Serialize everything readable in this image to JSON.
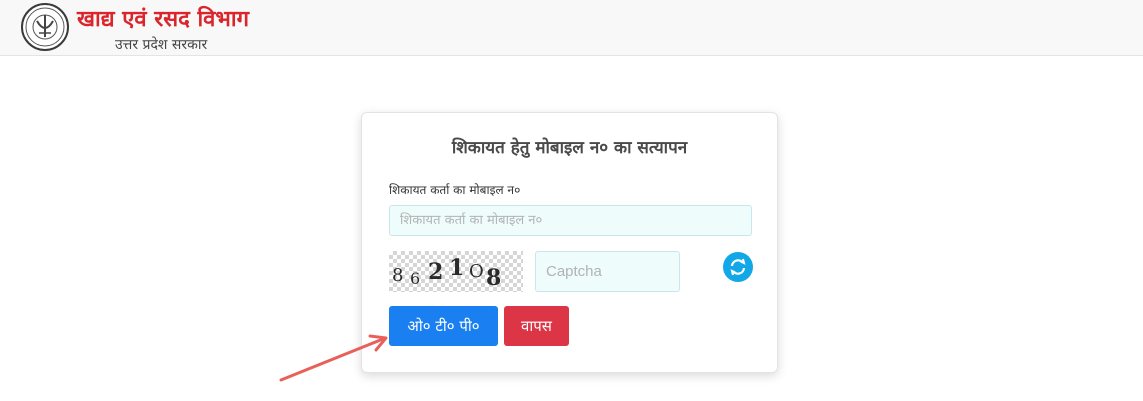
{
  "header": {
    "title": "खाद्य एवं रसद विभाग",
    "subtitle": "उत्तर प्रदेश सरकार",
    "logo_icon": "up-government-emblem"
  },
  "card": {
    "title": "शिकायत हेतु मोबाइल न० का सत्यापन",
    "mobile_label": "शिकायत कर्ता का मोबाइल न०",
    "mobile_placeholder": "शिकायत कर्ता का मोबाइल न०",
    "mobile_value": "",
    "captcha_chars": [
      "8",
      "6",
      "2",
      "1",
      "O",
      "8"
    ],
    "captcha_placeholder": "Captcha",
    "captcha_value": "",
    "refresh_icon": "refresh-icon",
    "otp_button_label": "ओ० टी० पी०",
    "back_button_label": "वापस"
  },
  "colors": {
    "title_red": "#d9262c",
    "otp_blue": "#1a7ff0",
    "back_red": "#dc3545",
    "refresh_blue": "#12a8e8",
    "arrow_red": "#e8605a"
  },
  "annotation": {
    "arrow_icon": "red-pointer-arrow"
  }
}
